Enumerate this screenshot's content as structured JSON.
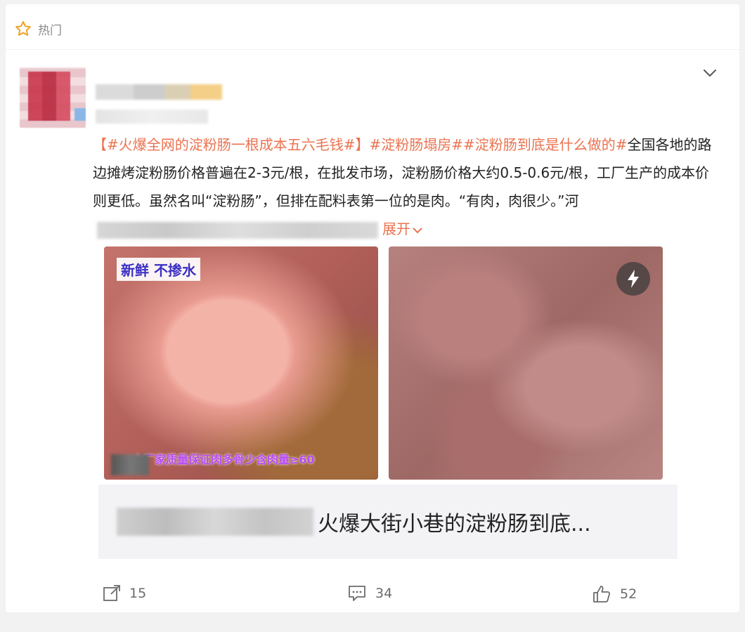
{
  "header": {
    "hot_label": "热门"
  },
  "post": {
    "topic_main": "【#火爆全网的淀粉肠一根成本五六毛钱#】",
    "topic_2": "#淀粉肠塌房#",
    "topic_3": "#淀粉肠到底是什么做的#",
    "body_line1_tail": "全国",
    "body_rest": "各地的路边摊烤淀粉肠价格普遍在2-3元/根，在批发市场，淀粉肠价格大约0.5-0.6元/根，工厂生产的成本价则更低。虽然名叫“淀粉肠”，但排在配料表第一位的是肉。“有肉，肉很少。”河",
    "expand_label": "展开"
  },
  "images": {
    "photo1_tag": "新鲜 不掺水",
    "photo1_caption": "大厂家质量保证肉多骨少含肉量≥60"
  },
  "repost": {
    "title": "火爆大街小巷的淀粉肠到底..."
  },
  "actions": {
    "share_count": "15",
    "comment_count": "34",
    "like_count": "52"
  },
  "icons": {
    "hot": "star-outline-icon",
    "more": "chevron-down-icon",
    "live": "lightning-icon",
    "share": "share-icon",
    "comment": "comment-icon",
    "like": "thumbs-up-icon"
  },
  "colors": {
    "topic": "#eb7350",
    "hot_star": "#f0a020"
  }
}
